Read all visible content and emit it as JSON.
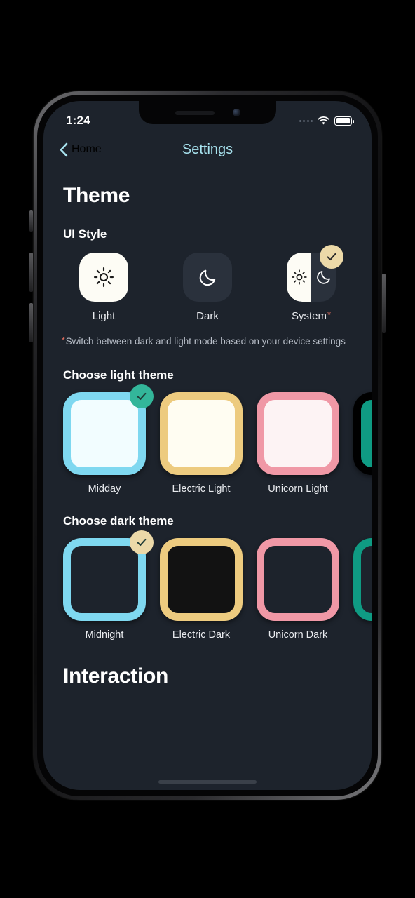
{
  "status_bar": {
    "time": "1:24",
    "signal_icon": "signal-dots-icon",
    "wifi_icon": "wifi-icon",
    "battery_icon": "battery-full-icon"
  },
  "nav": {
    "back_label": "Home",
    "back_icon": "chevron-left-icon",
    "title": "Settings",
    "accent": "#a8e3ef"
  },
  "sections": {
    "theme_heading": "Theme",
    "ui_style_heading": "UI Style",
    "footnote_marker": "*",
    "footnote": "Switch between dark and light mode based on your device settings",
    "light_theme_heading": "Choose light theme",
    "dark_theme_heading": "Choose dark theme",
    "interaction_heading": "Interaction"
  },
  "ui_style": {
    "selected": "System",
    "options": [
      {
        "label": "Light",
        "icon": "sun-icon",
        "selected": false,
        "has_asterisk": false
      },
      {
        "label": "Dark",
        "icon": "moon-icon",
        "selected": false,
        "has_asterisk": false
      },
      {
        "label": "System",
        "icon": "sun-moon-split-icon",
        "selected": true,
        "has_asterisk": true
      }
    ],
    "check_icon": "check-icon",
    "badge_color": "#ecd9a8"
  },
  "light_themes": {
    "selected": "Midday",
    "check_icon": "check-icon",
    "badge_color": "#33b69a",
    "items": [
      {
        "label": "Midday",
        "border": "#7fd8f0",
        "fill": "#f2fdff",
        "selected": true
      },
      {
        "label": "Electric Light",
        "border": "#edcb7f",
        "fill": "#fffdf2",
        "selected": false
      },
      {
        "label": "Unicorn Light",
        "border": "#f098a6",
        "fill": "#fdf3f4",
        "selected": false
      },
      {
        "label": "",
        "border": "#11a храм",
        "fill": "#0f9b83",
        "selected": false
      }
    ]
  },
  "dark_themes": {
    "selected": "Midnight",
    "check_icon": "check-icon",
    "badge_color": "#ecd9a8",
    "items": [
      {
        "label": "Midnight",
        "border": "#7fd8f0",
        "fill": "#1d232c",
        "selected": true
      },
      {
        "label": "Electric Dark",
        "border": "#edcb7f",
        "fill": "#121212",
        "selected": false
      },
      {
        "label": "Unicorn Dark",
        "border": "#f098a6",
        "fill": "#1d232c",
        "selected": false
      },
      {
        "label": "",
        "border": "#0f9b83",
        "fill": "#1d232c",
        "selected": false
      }
    ]
  },
  "screen_bg": "#1d232c"
}
